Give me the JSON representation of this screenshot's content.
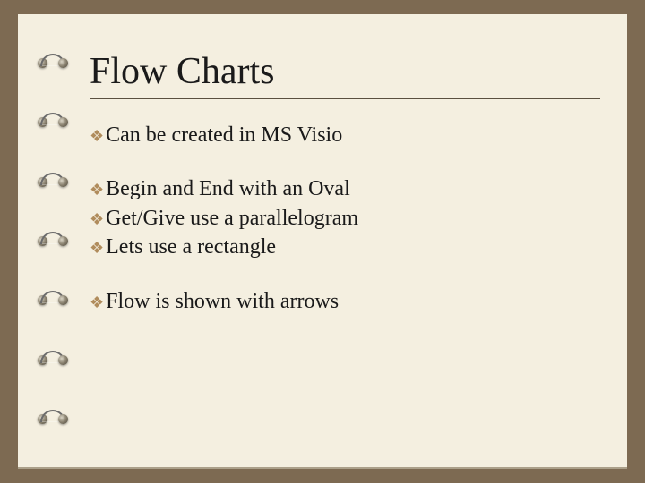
{
  "title": "Flow Charts",
  "groups": [
    {
      "items": [
        "Can be created in MS Visio"
      ]
    },
    {
      "items": [
        "Begin and End with an Oval",
        "Get/Give use a parallelogram",
        "Lets use a rectangle"
      ]
    },
    {
      "items": [
        "Flow is shown with arrows"
      ]
    }
  ]
}
